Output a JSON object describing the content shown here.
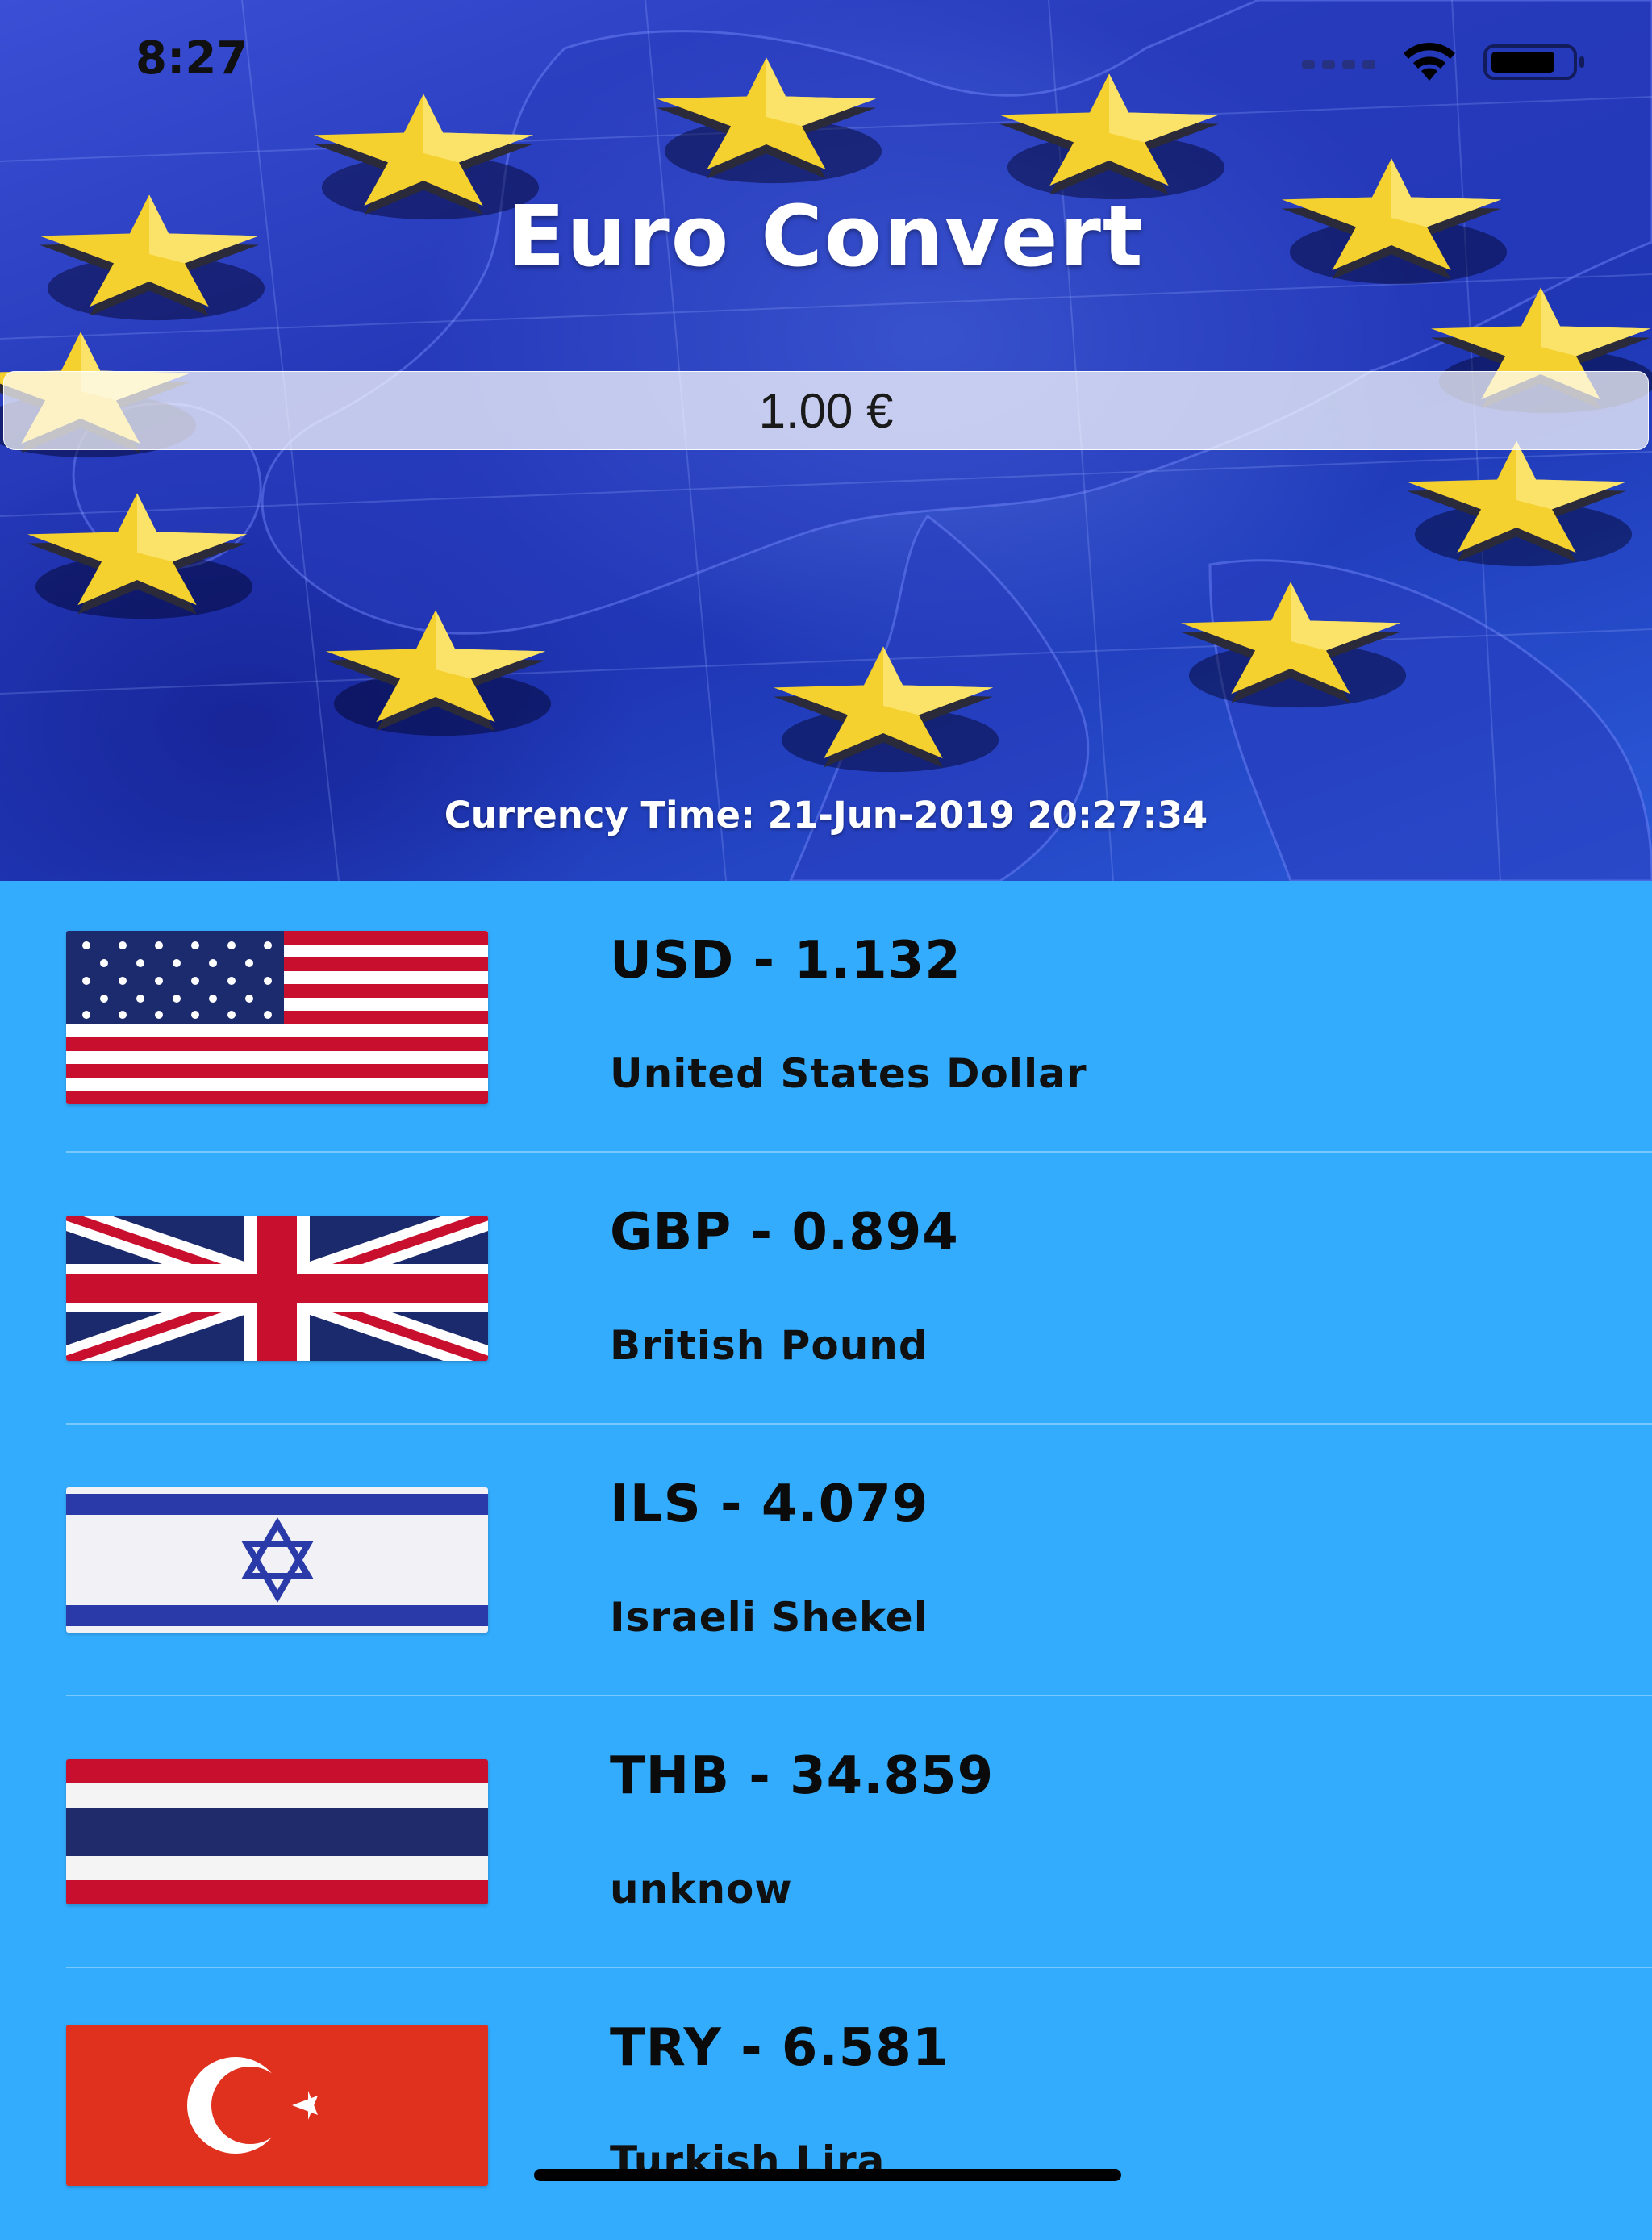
{
  "status_bar": {
    "time": "8:27"
  },
  "header": {
    "title": "Euro Convert",
    "amount_value": "1.00 €",
    "currency_time": "Currency Time: 21-Jun-2019 20:27:34"
  },
  "currencies": [
    {
      "code_rate": "USD - 1.132",
      "name": "United States Dollar",
      "flag_icon": "us-flag-icon"
    },
    {
      "code_rate": "GBP - 0.894",
      "name": "British Pound",
      "flag_icon": "uk-flag-icon"
    },
    {
      "code_rate": "ILS - 4.079",
      "name": "Israeli Shekel",
      "flag_icon": "israel-flag-icon"
    },
    {
      "code_rate": "THB - 34.859",
      "name": "unknow",
      "flag_icon": "thailand-flag-icon"
    },
    {
      "code_rate": "TRY - 6.581",
      "name": "Turkish Lira",
      "flag_icon": "turkey-flag-icon"
    }
  ],
  "colors": {
    "list_background": "#33acfd",
    "star": "#f5d130",
    "hero_blue": "#2438b8"
  }
}
